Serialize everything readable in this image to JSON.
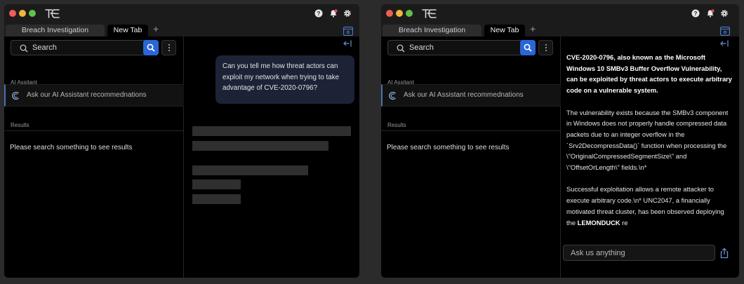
{
  "colors": {
    "accent": "#2a66d8",
    "bubble": "#1c2336",
    "background": "#000000"
  },
  "windows": [
    {
      "tabs": [
        {
          "label": "Breach Investigation",
          "active": false
        },
        {
          "label": "New Tab",
          "active": true
        }
      ],
      "search": {
        "placeholder": "Search"
      },
      "sections": {
        "ai_assistant": "AI Assitant",
        "results": "Results"
      },
      "ai_row": {
        "label": "Ask our AI Assistant recommednations"
      },
      "empty_message": "Please search something to see results",
      "chat": {
        "user_message": "Can you tell me how threat actors can exploit my network when trying to take advantage of CVE-2020-0796?",
        "state": "loading"
      }
    },
    {
      "tabs": [
        {
          "label": "Breach Investigation",
          "active": false
        },
        {
          "label": "New Tab",
          "active": true
        }
      ],
      "search": {
        "placeholder": "Search"
      },
      "sections": {
        "ai_assistant": "AI Assitant",
        "results": "Results"
      },
      "ai_row": {
        "label": "Ask our AI Assistant recommednations"
      },
      "empty_message": "Please search something to see results",
      "chat": {
        "response_heading": "CVE-2020-0796, also known as the Microsoft Windows 10 SMBv3 Buffer Overflow Vulnerability, can be exploited by threat actors to execute arbitrary code on a vulnerable system.",
        "response_p2": "The vulnerability exists because the SMBv3 component in Windows does not properly handle compressed data packets due to an integer overflow in the `Srv2DecompressData()` function when processing the \\\"OriginalCompressedSegmentSize\\\" and \\\"OffsetOrLength\\\" fields.\\n*",
        "response_p3_start": "Successful exploitation allows a remote attacker to execute arbitrary code.\\n*   UNC2047, a financially motivated threat cluster, has been observed deploying the ",
        "response_p3_bold": "LEMONDUCK",
        "response_p3_end": " re",
        "ask_placeholder": "Ask us anything"
      }
    }
  ],
  "icons": [
    "help-icon",
    "notification-bell-icon",
    "settings-gear-icon",
    "search-icon",
    "kebab-menu-icon",
    "panel-toggle-icon",
    "collapse-panel-icon",
    "ai-assistant-icon",
    "share-icon"
  ]
}
